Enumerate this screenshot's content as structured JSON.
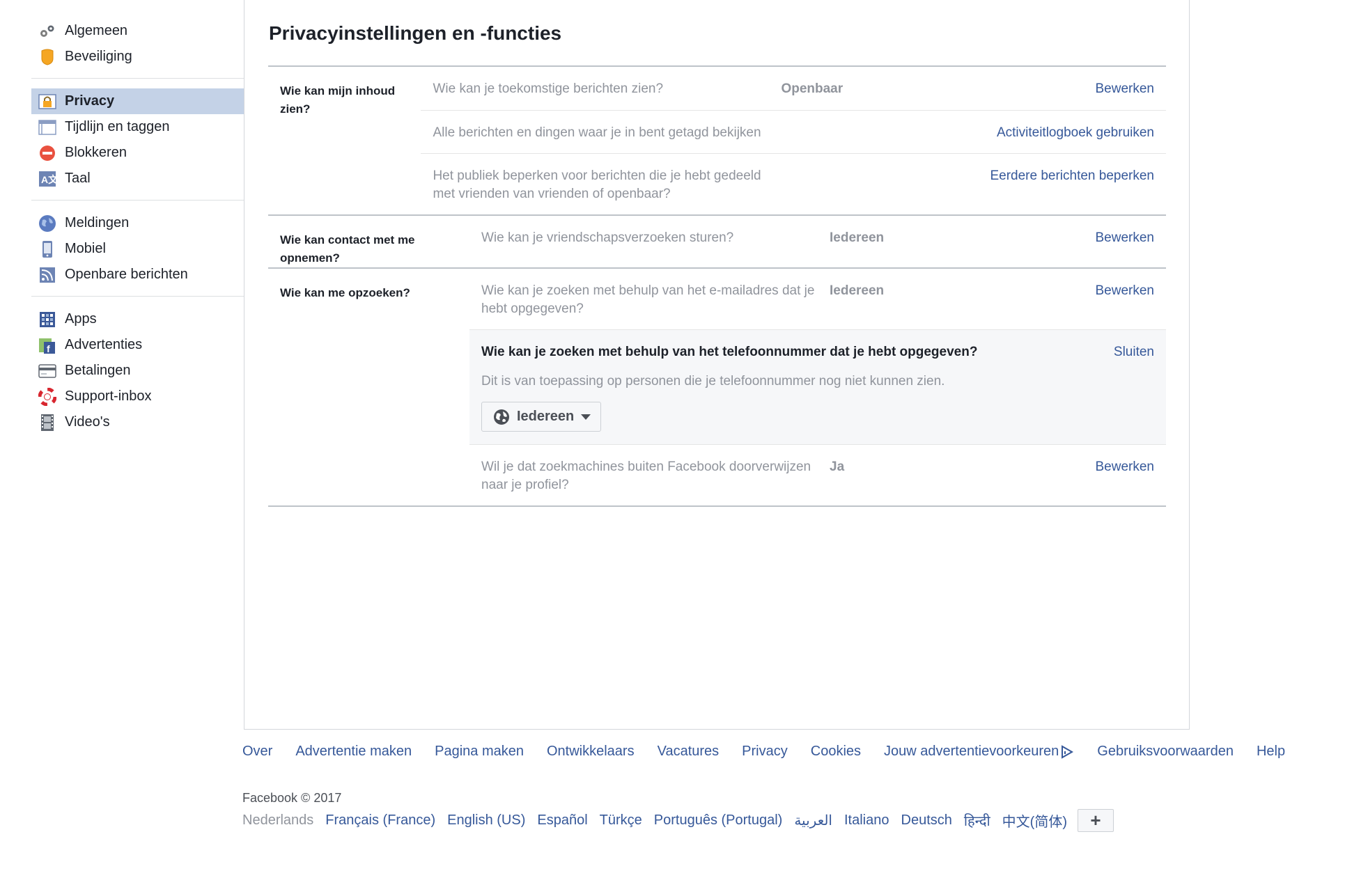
{
  "sidebar": {
    "groups": [
      {
        "items": [
          {
            "label": "Algemeen",
            "icon": "gears-icon"
          },
          {
            "label": "Beveiliging",
            "icon": "shield-icon"
          }
        ]
      },
      {
        "items": [
          {
            "label": "Privacy",
            "icon": "lock-icon",
            "active": true
          },
          {
            "label": "Tijdlijn en taggen",
            "icon": "timeline-icon"
          },
          {
            "label": "Blokkeren",
            "icon": "block-icon"
          },
          {
            "label": "Taal",
            "icon": "language-icon"
          }
        ]
      },
      {
        "items": [
          {
            "label": "Meldingen",
            "icon": "globe-icon"
          },
          {
            "label": "Mobiel",
            "icon": "mobile-icon"
          },
          {
            "label": "Openbare berichten",
            "icon": "rss-icon"
          }
        ]
      },
      {
        "items": [
          {
            "label": "Apps",
            "icon": "apps-icon"
          },
          {
            "label": "Advertenties",
            "icon": "ads-icon"
          },
          {
            "label": "Betalingen",
            "icon": "credit-card-icon"
          },
          {
            "label": "Support-inbox",
            "icon": "lifebuoy-icon"
          },
          {
            "label": "Video's",
            "icon": "film-icon"
          }
        ]
      }
    ]
  },
  "main": {
    "title": "Privacyinstellingen en -functies",
    "sections": [
      {
        "label": "Wie kan mijn inhoud zien?",
        "rows": [
          {
            "question": "Wie kan je toekomstige berichten zien?",
            "value": "Openbaar",
            "action": "Bewerken"
          },
          {
            "question": "Alle berichten en dingen waar je in bent getagd bekijken",
            "value": "",
            "action": "Activiteitlogboek gebruiken"
          },
          {
            "question": "Het publiek beperken voor berichten die je hebt gedeeld met vrienden van vrienden of openbaar?",
            "value": "",
            "action": "Eerdere berichten beperken"
          }
        ]
      },
      {
        "label": "Wie kan contact met me opnemen?",
        "rows": [
          {
            "question": "Wie kan je vriendschapsverzoeken sturen?",
            "value": "Iedereen",
            "action": "Bewerken"
          }
        ]
      },
      {
        "label": "Wie kan me opzoeken?",
        "rows": [
          {
            "question": "Wie kan je zoeken met behulp van het e-mailadres dat je hebt opgegeven?",
            "value": "Iedereen",
            "action": "Bewerken"
          }
        ],
        "expanded": {
          "question": "Wie kan je zoeken met behulp van het telefoonnummer dat je hebt opgegeven?",
          "close": "Sluiten",
          "description": "Dit is van toepassing op personen die je telefoonnummer nog niet kunnen zien.",
          "audience": "Iedereen"
        },
        "rows_after": [
          {
            "question": "Wil je dat zoekmachines buiten Facebook doorverwijzen naar je profiel?",
            "value": "Ja",
            "action": "Bewerken"
          }
        ]
      }
    ]
  },
  "footer": {
    "links": [
      "Over",
      "Advertentie maken",
      "Pagina maken",
      "Ontwikkelaars",
      "Vacatures",
      "Privacy",
      "Cookies",
      "Jouw advertentievoorkeuren",
      "Gebruiksvoorwaarden",
      "Help"
    ],
    "copyright": "Facebook © 2017",
    "current_language": "Nederlands",
    "languages": [
      "Français (France)",
      "English (US)",
      "Español",
      "Türkçe",
      "Português (Portugal)",
      "العربية",
      "Italiano",
      "Deutsch",
      "हिन्दी",
      "中文(简体)"
    ],
    "more_button": "+"
  },
  "colors": {
    "link": "#365899",
    "active_bg": "#c4d2e7",
    "muted": "#90949c"
  }
}
